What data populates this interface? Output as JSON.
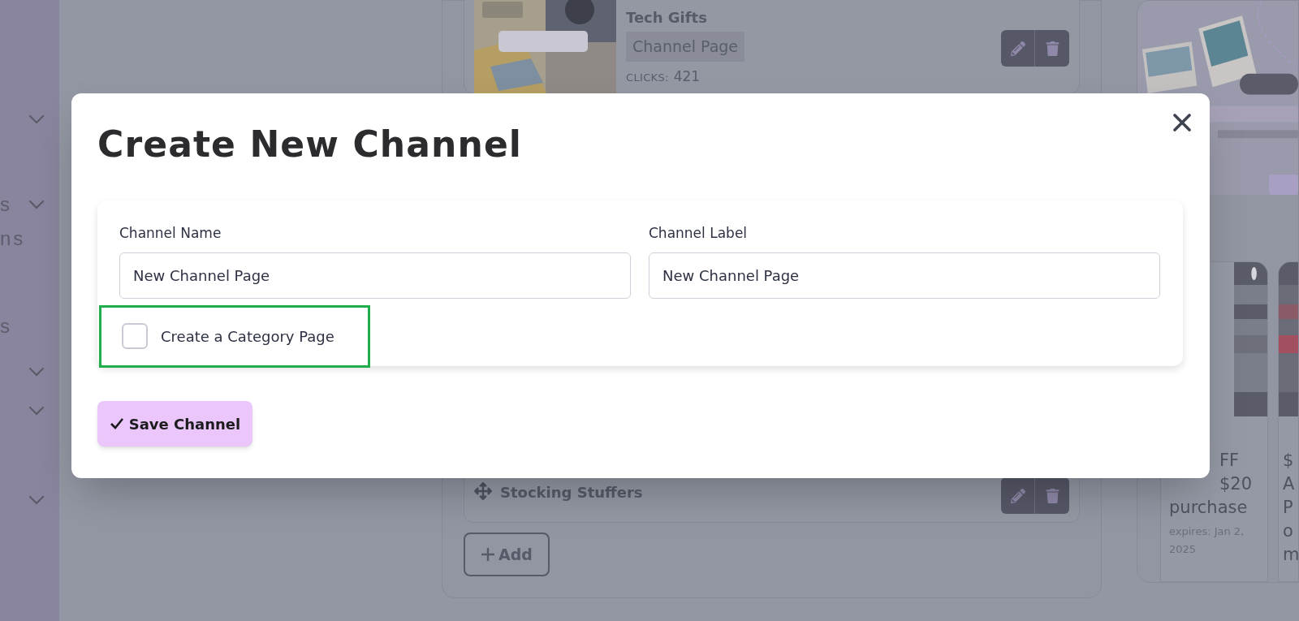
{
  "sidebar": {
    "items": [
      {
        "expandable": true
      },
      {
        "label": "s",
        "expandable": true
      },
      {
        "label": "ns",
        "expandable": false
      },
      {
        "label": "s",
        "expandable": false
      },
      {
        "expandable": true
      },
      {
        "expandable": true
      },
      {
        "expandable": true
      }
    ]
  },
  "channels": [
    {
      "kind": "thumb",
      "title": "Tech Gifts",
      "badge": "Channel Page",
      "clicks_label": "CLICKS:",
      "clicks": "421"
    },
    {
      "kind": "drag",
      "title": "Stocking Stuffers"
    }
  ],
  "add_button": "Add",
  "deals": [
    {
      "lines_hidden": [
        "FF",
        "$20"
      ],
      "lines": [
        "purchase"
      ],
      "expires": "expires: Jan 2, 2025"
    },
    {
      "lines": [
        "$",
        "A",
        "P",
        "o",
        "m"
      ]
    }
  ],
  "modal": {
    "title": "Create New Channel",
    "fields": [
      {
        "label": "Channel Name",
        "value": "New Channel Page"
      },
      {
        "label": "Channel Label",
        "value": "New Channel Page"
      }
    ],
    "category_checkbox": {
      "label": "Create a Category Page",
      "checked": false,
      "highlighted": true
    },
    "save_button": "Save Channel"
  }
}
